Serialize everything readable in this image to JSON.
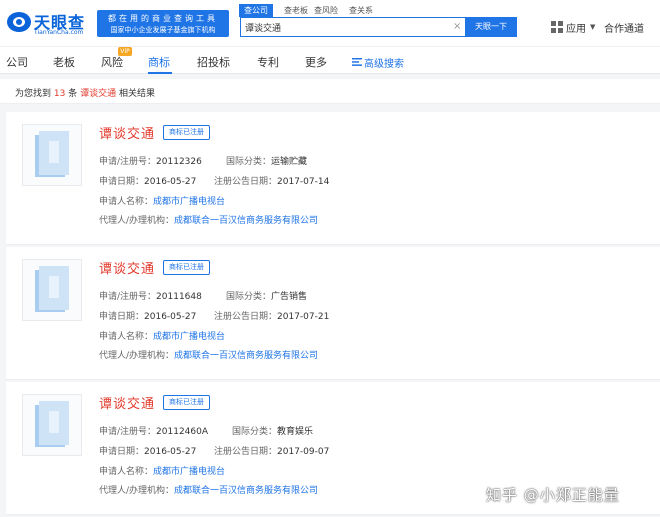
{
  "header": {
    "logo_text": "天眼查",
    "logo_sub": "TianYanCha.com",
    "slogan_line1": "都在用的商业查询工具",
    "slogan_line2": "国家中小企业发展子基金旗下机构",
    "search_tabs": [
      "查公司",
      "查老板",
      "查风险",
      "查关系"
    ],
    "search_value": "谭谈交通",
    "search_button": "天眼一下",
    "app_label": "应用",
    "user_label": "合作通道"
  },
  "nav": {
    "items": [
      "公司",
      "老板",
      "风险",
      "商标",
      "招投标",
      "专利",
      "更多"
    ],
    "active": "商标",
    "vip_badge": "VIP",
    "advanced_search": "高级搜索"
  },
  "results_summary": {
    "prefix": "为您找到",
    "count": "13",
    "unit": "条",
    "keyword": "谭谈交通",
    "suffix": "相关结果"
  },
  "labels": {
    "reg_no": "申请/注册号：",
    "intl_class": "国际分类：",
    "apply_date": "申请日期：",
    "pub_date": "注册公告日期：",
    "applicant": "申请人名称：",
    "agent": "代理人/办理机构："
  },
  "results": [
    {
      "name": "谭谈交通",
      "status": "商标已注册",
      "reg_no": "20112326",
      "intl_class": "运输贮藏",
      "apply_date": "2016-05-27",
      "pub_date": "2017-07-14",
      "applicant": "成都市广播电视台",
      "agent": "成都联合一百汉信商务服务有限公司"
    },
    {
      "name": "谭谈交通",
      "status": "商标已注册",
      "reg_no": "20111648",
      "intl_class": "广告销售",
      "apply_date": "2016-05-27",
      "pub_date": "2017-07-21",
      "applicant": "成都市广播电视台",
      "agent": "成都联合一百汉信商务服务有限公司"
    },
    {
      "name": "谭谈交通",
      "status": "商标已注册",
      "reg_no": "20112460A",
      "intl_class": "教育娱乐",
      "apply_date": "2016-05-27",
      "pub_date": "2017-09-07",
      "applicant": "成都市广播电视台",
      "agent": "成都联合一百汉信商务服务有限公司"
    }
  ],
  "watermark": "知乎 @小郑正能量",
  "colors": {
    "brand_blue": "#1f74e6",
    "highlight_red": "#e23a2c"
  }
}
